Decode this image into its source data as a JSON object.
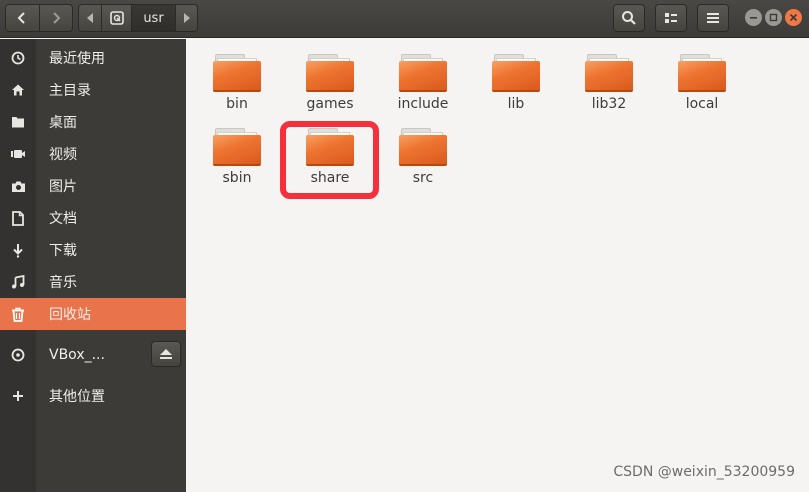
{
  "header": {
    "path_segment": "usr",
    "back_icon": "chevron-left-icon",
    "forward_icon": "chevron-right-icon",
    "search_icon": "search-icon",
    "view_icon": "list-view-icon",
    "menu_icon": "hamburger-menu-icon"
  },
  "sidebar": {
    "items": [
      {
        "label": "最近使用",
        "icon": "clock-icon"
      },
      {
        "label": "主目录",
        "icon": "home-icon"
      },
      {
        "label": "桌面",
        "icon": "folder-icon"
      },
      {
        "label": "视频",
        "icon": "video-icon"
      },
      {
        "label": "图片",
        "icon": "camera-icon"
      },
      {
        "label": "文档",
        "icon": "document-icon"
      },
      {
        "label": "下载",
        "icon": "download-icon"
      },
      {
        "label": "音乐",
        "icon": "music-icon"
      },
      {
        "label": "回收站",
        "icon": "trash-icon",
        "active": true
      },
      {
        "label": "VBox_...",
        "icon": "disc-icon"
      },
      {
        "label": "其他位置",
        "icon": "plus-icon"
      }
    ]
  },
  "files": [
    {
      "name": "bin"
    },
    {
      "name": "games"
    },
    {
      "name": "include"
    },
    {
      "name": "lib"
    },
    {
      "name": "lib32"
    },
    {
      "name": "local"
    },
    {
      "name": "sbin"
    },
    {
      "name": "share",
      "highlighted": true
    },
    {
      "name": "src"
    }
  ],
  "watermark": "CSDN @weixin_53200959",
  "colors": {
    "accent": "#e9734a",
    "highlight_border": "#f5303d",
    "sidebar_bg": "#3c3b37"
  }
}
